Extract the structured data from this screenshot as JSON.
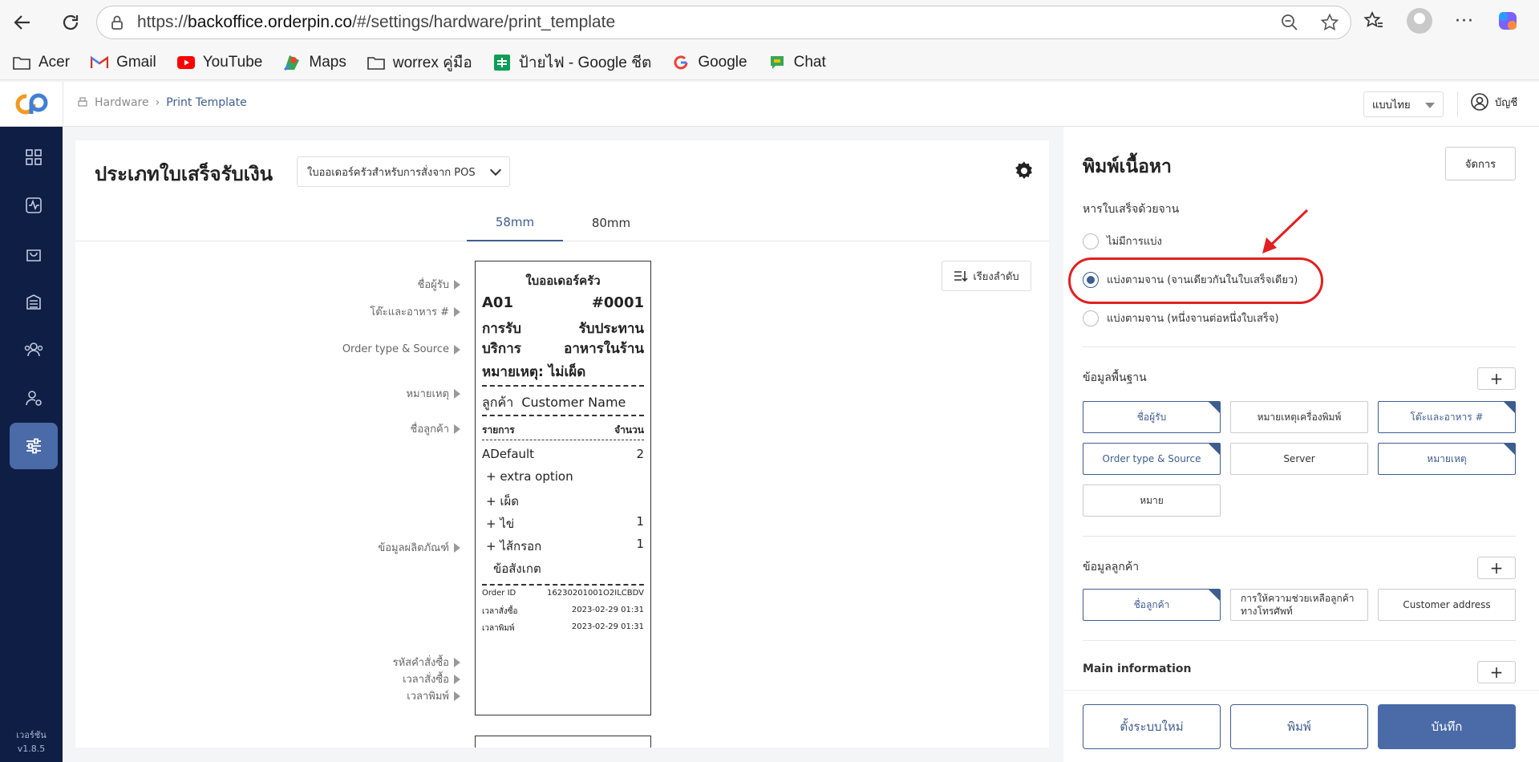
{
  "browser": {
    "url_scheme": "https://",
    "url_host": "backoffice.orderpin.co",
    "url_path": "/#/settings/hardware/print_template"
  },
  "bookmarks": [
    {
      "label": "Acer",
      "icon": "folder-icon"
    },
    {
      "label": "Gmail",
      "icon": "gmail-icon"
    },
    {
      "label": "YouTube",
      "icon": "youtube-icon"
    },
    {
      "label": "Maps",
      "icon": "maps-icon"
    },
    {
      "label": "worrex คู่มือ",
      "icon": "folder-icon"
    },
    {
      "label": "ป้ายไฟ - Google ชีต",
      "icon": "sheets-icon"
    },
    {
      "label": "Google",
      "icon": "google-icon"
    },
    {
      "label": "Chat",
      "icon": "chat-icon"
    }
  ],
  "header": {
    "breadcrumb_root": "Hardware",
    "breadcrumb_current": "Print Template",
    "language": "แบบไทย",
    "account": "บัญชี"
  },
  "sidebar": {
    "version_label": "เวอร์ชัน",
    "version": "v1.8.5"
  },
  "main": {
    "title": "ประเภทใบเสร็จรับเงิน",
    "receipt_type": "ใบออเดอร์ครัวสำหรับการสั่งจาก POS",
    "tabs": [
      "58mm",
      "80mm"
    ],
    "sort_button": "เรียงลำดับ",
    "field_labels": {
      "receiver": "ชื่อผู้รับ",
      "table_food": "โต๊ะและอาหาร #",
      "order_type": "Order type & Source",
      "note": "หมายเหตุ",
      "customer": "ชื่อลูกค้า",
      "product": "ข้อมูลผลิตภัณฑ์",
      "order_code": "รหัสคำสั่งซื้อ",
      "order_time": "เวลาสั่งซื้อ",
      "print_time": "เวลาพิมพ์"
    }
  },
  "receipt": {
    "title": "ใบออเดอร์ครัว",
    "table": "A01",
    "number": "#0001",
    "service_1": "การรับ",
    "service_2": "บริการ",
    "dine_1": "รับประทาน",
    "dine_2": "อาหารในร้าน",
    "note": "หมายเหตุ: ไม่เผ็ด",
    "customer_label": "ลูกค้า",
    "customer_name": "Customer Name",
    "col_item": "รายการ",
    "col_qty": "จำนวน",
    "items": [
      {
        "name": "ADefault",
        "qty": "2"
      },
      {
        "name": "+ extra option",
        "qty": ""
      },
      {
        "name": "+ เผ็ด",
        "qty": ""
      },
      {
        "name": "+ ไข่",
        "qty": "1"
      },
      {
        "name": "+ ไส้กรอก",
        "qty": "1"
      },
      {
        "name": "ข้อสังเกต",
        "qty": ""
      }
    ],
    "order_id_label": "Order ID",
    "order_id": "16230201001O2ILCBDV",
    "order_time_label": "เวลาสั่งซื้อ",
    "order_time": "2023-02-29 01:31",
    "print_time_label": "เวลาพิมพ์",
    "print_time": "2023-02-29 01:31"
  },
  "panel": {
    "title": "พิมพ์เนื้อหา",
    "manage": "จัดการ",
    "split_label": "หารใบเสร็จด้วยจาน",
    "split_options": [
      {
        "label": "ไม่มีการแบ่ง",
        "checked": false
      },
      {
        "label": "แบ่งตามจาน (จานเดียวกันในใบเสร็จเดียว)",
        "checked": true
      },
      {
        "label": "แบ่งตามจาน (หนึ่งจานต่อหนึ่งใบเสร็จ)",
        "checked": false
      }
    ],
    "basic_label": "ข้อมูลพื้นฐาน",
    "basic_chips": [
      {
        "label": "ชื่อผู้รับ",
        "selected": true
      },
      {
        "label": "หมายเหตุเครื่องพิมพ์",
        "selected": false
      },
      {
        "label": "โต๊ะและอาหาร #",
        "selected": true
      },
      {
        "label": "Order type & Source",
        "selected": true
      },
      {
        "label": "Server",
        "selected": false
      },
      {
        "label": "หมายเหตุ",
        "selected": true
      },
      {
        "label": "หมาย",
        "selected": false
      }
    ],
    "customer_label": "ข้อมูลลูกค้า",
    "customer_chips": [
      {
        "label": "ชื่อลูกค้า",
        "selected": true
      },
      {
        "label": "การให้ความช่วยเหลือลูกค้าทางโทรศัพท์",
        "selected": false
      },
      {
        "label": "Customer address",
        "selected": false
      }
    ],
    "main_info_label": "Main information",
    "reset": "ตั้งระบบใหม่",
    "print": "พิมพ์",
    "save": "บันทึก"
  },
  "colors": {
    "accent": "#3e5d8f",
    "sidebar": "#0f1e45",
    "highlight": "#e02020"
  }
}
